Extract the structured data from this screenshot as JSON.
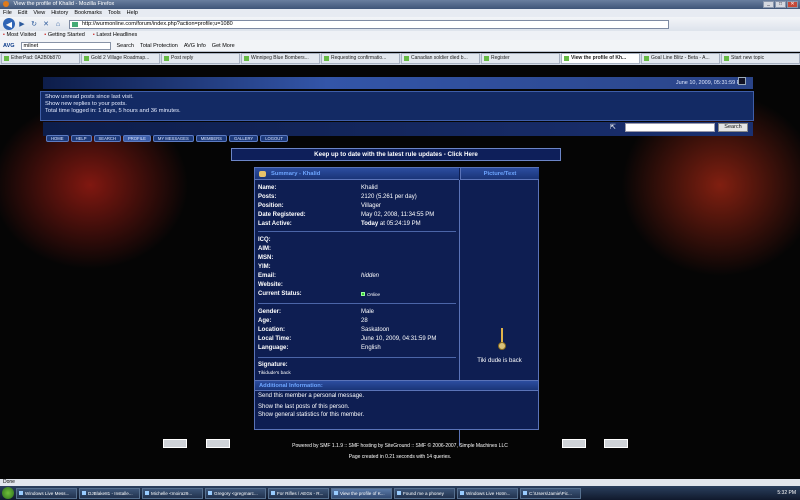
{
  "window": {
    "title": "View the profile of Khalid - Mozilla Firefox",
    "controls": {
      "minimize": "_",
      "maximize": "□",
      "close": "✕"
    }
  },
  "menubar": [
    "File",
    "Edit",
    "View",
    "History",
    "Bookmarks",
    "Tools",
    "Help"
  ],
  "navbar": {
    "url": "http://wurmonline.com/forum/index.php?action=profile;u=1080"
  },
  "bookmarks": [
    "Most Visited",
    "Getting Started",
    "Latest Headlines"
  ],
  "avg_toolbar": {
    "logo": "AVG",
    "search_value": "milnet",
    "search_label": "Search",
    "total_protection": "Total Protection",
    "avg_info": "AVG Info",
    "get_more": "Get More"
  },
  "tabs": [
    {
      "label": "EtherPad: 0A2B0b870",
      "active": false
    },
    {
      "label": "Gold 2 Village Roadmap...",
      "active": false
    },
    {
      "label": "Post reply",
      "active": false
    },
    {
      "label": "Winnipeg Blue Bombers...",
      "active": false
    },
    {
      "label": "Requesting confirmatio...",
      "active": false
    },
    {
      "label": "Canadian soldier died b...",
      "active": false
    },
    {
      "label": "Register",
      "active": false
    },
    {
      "label": "View the profile of Kh...",
      "active": true
    },
    {
      "label": "Goal Line Blitz - Beta - A...",
      "active": false
    },
    {
      "label": "Start new topic",
      "active": false
    }
  ],
  "forum": {
    "date": "June 10, 2009, 05:31:59 PM",
    "info_lines": [
      "Show unread posts since last visit.",
      "Show new replies to your posts.",
      "Total time logged in: 1 days, 5 hours and 36 minutes."
    ],
    "menu": [
      "HOME",
      "HELP",
      "SEARCH",
      "PROFILE",
      "MY MESSAGES",
      "MEMBERS",
      "GALLERY",
      "LOGOUT"
    ],
    "search_button": "Search",
    "rules_text": "Keep up to date with the latest rule updates - Click Here"
  },
  "profile": {
    "summary_title": "Summary - Khalid",
    "picture_title": "Picture/Text",
    "group1": [
      {
        "label": "Name:",
        "value": "Khalid"
      },
      {
        "label": "Posts:",
        "value": "2120 (5.261 per day)"
      },
      {
        "label": "Position:",
        "value": "Villager"
      },
      {
        "label": "Date Registered:",
        "value": "May 02, 2008, 11:34:55 PM"
      },
      {
        "label": "Last Active:",
        "value_bold": "Today",
        "value": " at 05:24:19 PM"
      }
    ],
    "group2": [
      {
        "label": "ICQ:",
        "value": ""
      },
      {
        "label": "AIM:",
        "value": ""
      },
      {
        "label": "MSN:",
        "value": ""
      },
      {
        "label": "YIM:",
        "value": ""
      },
      {
        "label": "Email:",
        "value": "hidden"
      },
      {
        "label": "Website:",
        "value": ""
      },
      {
        "label": "Current Status:",
        "value": "Online"
      }
    ],
    "group3": [
      {
        "label": "Gender:",
        "value": "Male"
      },
      {
        "label": "Age:",
        "value": "28"
      },
      {
        "label": "Location:",
        "value": "Saskatoon"
      },
      {
        "label": "Local Time:",
        "value": "June 10, 2009, 04:31:59 PM"
      },
      {
        "label": "Language:",
        "value": "English"
      }
    ],
    "signature_label": "Signature:",
    "signature_text": "Tikidude's back",
    "picture_caption": "Tiki dude is back"
  },
  "additional": {
    "title": "Additional Information:",
    "send_pm": "Send this member a personal message.",
    "last_posts": "Show the last posts of this person.",
    "stats": "Show general statistics for this member."
  },
  "footer": {
    "powered": "Powered by SMF 1.1.9 :: SMF hosting by SiteGround :: SMF © 2006-2007, Simple Machines LLC",
    "page_created": "Page created in 0.21 seconds with 14 queries."
  },
  "status": "Done",
  "taskbar": {
    "tasks": [
      {
        "label": "Windows Live Mess...",
        "active": false
      },
      {
        "label": "DJBlake81 - Installe...",
        "active": false
      },
      {
        "label": "Michelle <moira29...",
        "active": false
      },
      {
        "label": "Gregory <gregmarc...",
        "active": false
      },
      {
        "label": "For Rifles / AEGs - R...",
        "active": false
      },
      {
        "label": "View the profile of K...",
        "active": true
      },
      {
        "label": "Found me a phoney",
        "active": false
      },
      {
        "label": "Windows Live Hotm...",
        "active": false
      },
      {
        "label": "C:\\Users\\Jamie\\Pic...",
        "active": false
      }
    ],
    "clock": "5:32 PM"
  }
}
